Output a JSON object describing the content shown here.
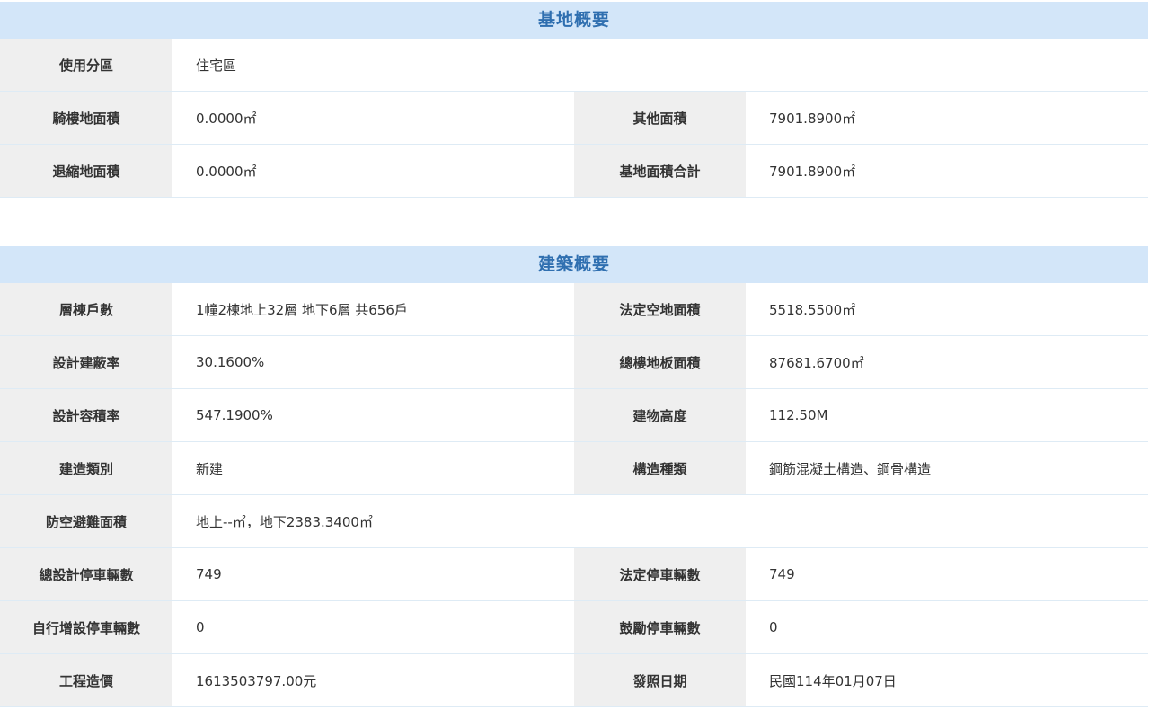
{
  "site": {
    "title": "基地概要",
    "rows": [
      {
        "label": "使用分區",
        "value": "住宅區"
      },
      {
        "label": "騎樓地面積",
        "value": "0.0000㎡",
        "label2": "其他面積",
        "value2": "7901.8900㎡"
      },
      {
        "label": "退縮地面積",
        "value": "0.0000㎡",
        "label2": "基地面積合計",
        "value2": "7901.8900㎡"
      }
    ]
  },
  "building": {
    "title": "建築概要",
    "rows": [
      {
        "label": "層棟戶數",
        "value": "1幢2棟地上32層 地下6層 共656戶",
        "label2": "法定空地面積",
        "value2": "5518.5500㎡"
      },
      {
        "label": "設計建蔽率",
        "value": "30.1600%",
        "label2": "總樓地板面積",
        "value2": "87681.6700㎡"
      },
      {
        "label": "設計容積率",
        "value": "547.1900%",
        "label2": "建物高度",
        "value2": "112.50M"
      },
      {
        "label": "建造類別",
        "value": "新建",
        "label2": "構造種類",
        "value2": "鋼筋混凝土構造、鋼骨構造"
      },
      {
        "label": "防空避難面積",
        "value": "地上--㎡，地下2383.3400㎡"
      },
      {
        "label": "總設計停車輛數",
        "value": "749",
        "label2": "法定停車輛數",
        "value2": "749"
      },
      {
        "label": "自行增設停車輛數",
        "value": "0",
        "label2": "鼓勵停車輛數",
        "value2": "0"
      },
      {
        "label": "工程造價",
        "value": "1613503797.00元",
        "label2": "發照日期",
        "value2": "民國114年01月07日"
      }
    ]
  }
}
